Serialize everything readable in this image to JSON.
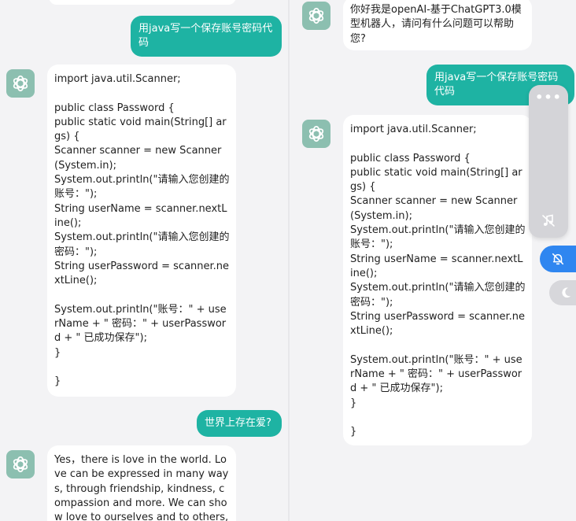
{
  "left": {
    "user_msg_1": "用java写一个保存账号密码代码",
    "bot_code": "import java.util.Scanner;\n\npublic class Password {\npublic static void main(String[] args) {\nScanner scanner = new Scanner(System.in);\nSystem.out.println(\"请输入您创建的账号：\");\nString userName = scanner.nextLine();\nSystem.out.println(\"请输入您创建的密码：\");\nString userPassword = scanner.nextLine();\n\nSystem.out.println(\"账号：\" + userName + \" 密码：\" + userPassword + \" 已成功保存\");\n}\n\n}",
    "user_msg_2": "世界上存在爱?",
    "bot_answer": "Yes，there is love in the world. Love can be expressed in many ways, through friendship, kindness, compassion and more. We can show love to ourselves and to others, an"
  },
  "right": {
    "bot_greeting": "你好我是openAI-基于ChatGPT3.0模型机器人，请问有什么问题可以帮助您?",
    "user_msg_1": "用java写一个保存账号密码代码",
    "bot_code": "import java.util.Scanner;\n\npublic class Password {\npublic static void main(String[] args) {\nScanner scanner = new Scanner(System.in);\nSystem.out.println(\"请输入您创建的账号：\");\nString userName = scanner.nextLine();\nSystem.out.println(\"请输入您创建的密码：\");\nString userPassword = scanner.nextLine();\n\nSystem.out.println(\"账号：\" + userName + \" 密码：\" + userPassword + \" 已成功保存\");\n}\n\n}"
  },
  "floating": {
    "more_dots": "•••"
  },
  "colors": {
    "user_bubble": "#1eb3a3",
    "avatar_bg": "#8cbfb0",
    "mute_button": "#2f86f0"
  }
}
